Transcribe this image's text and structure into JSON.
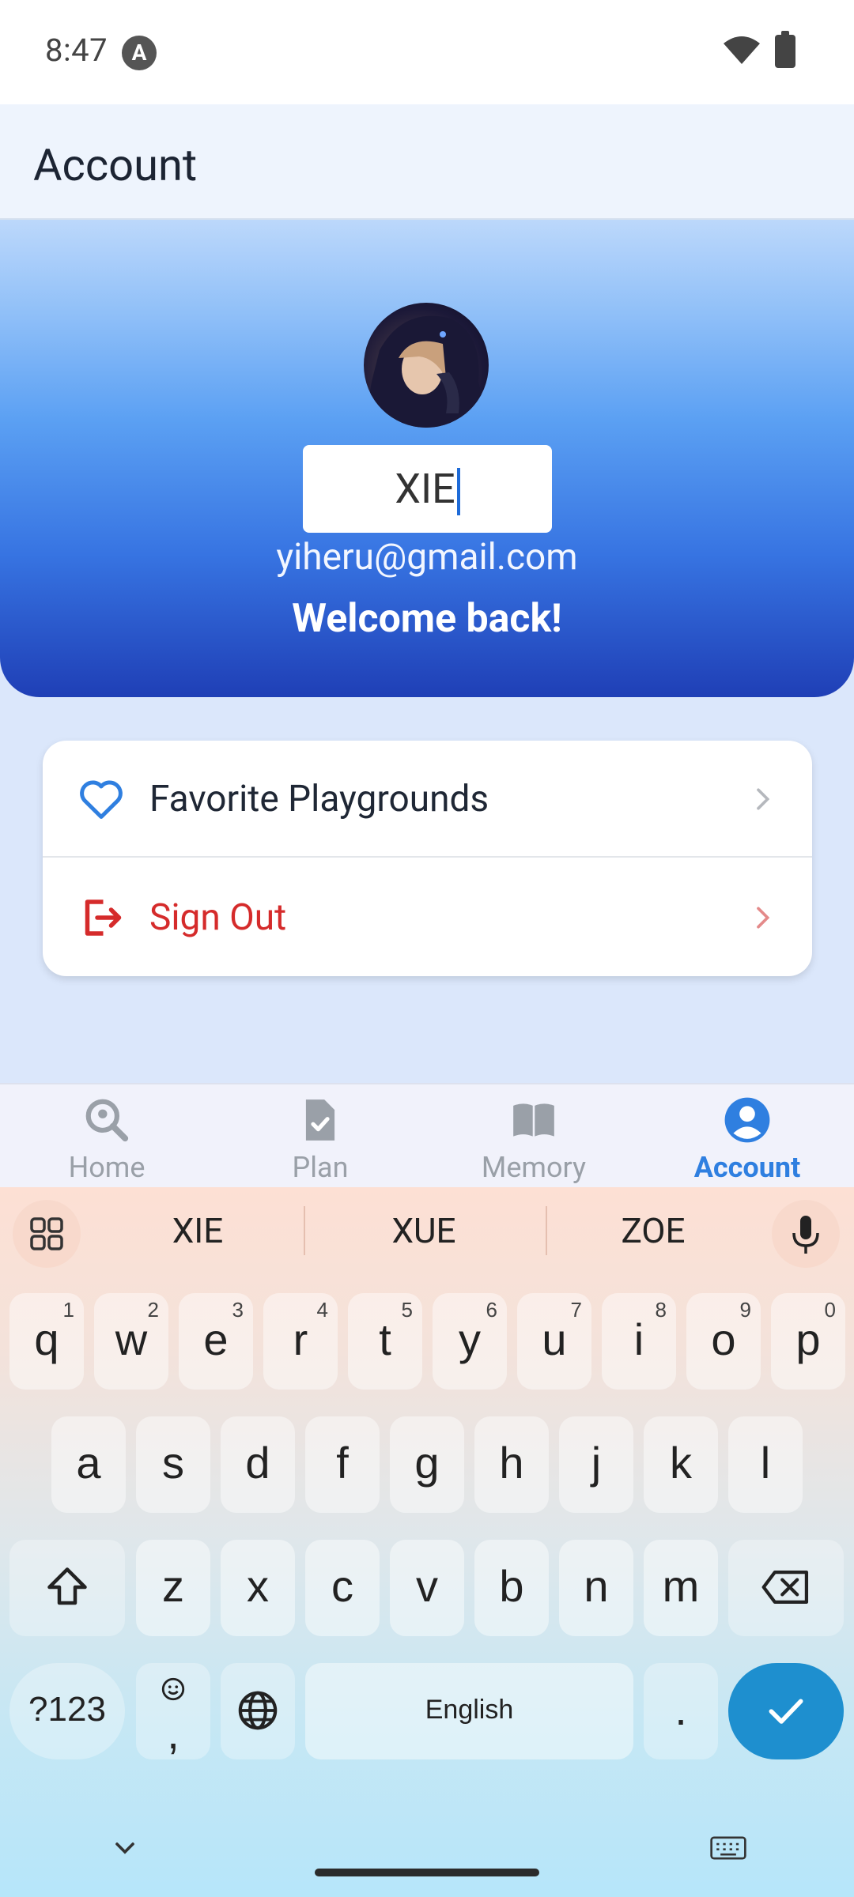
{
  "status_bar": {
    "time": "8:47",
    "notification_icon": "A"
  },
  "header": {
    "title": "Account"
  },
  "profile": {
    "name_value": "XIE",
    "email": "yiheru@gmail.com",
    "greeting": "Welcome back!"
  },
  "menu": {
    "favorites_label": "Favorite Playgrounds",
    "signout_label": "Sign Out"
  },
  "nav": {
    "items": [
      {
        "label": "Home",
        "icon": "search-location-icon"
      },
      {
        "label": "Plan",
        "icon": "file-check-icon"
      },
      {
        "label": "Memory",
        "icon": "book-icon"
      },
      {
        "label": "Account",
        "icon": "account-circle-icon",
        "active": true
      }
    ]
  },
  "keyboard": {
    "suggestions": [
      "XIE",
      "XUE",
      "ZOE"
    ],
    "row1": [
      {
        "k": "q",
        "n": "1"
      },
      {
        "k": "w",
        "n": "2"
      },
      {
        "k": "e",
        "n": "3"
      },
      {
        "k": "r",
        "n": "4"
      },
      {
        "k": "t",
        "n": "5"
      },
      {
        "k": "y",
        "n": "6"
      },
      {
        "k": "u",
        "n": "7"
      },
      {
        "k": "i",
        "n": "8"
      },
      {
        "k": "o",
        "n": "9"
      },
      {
        "k": "p",
        "n": "0"
      }
    ],
    "row2": [
      "a",
      "s",
      "d",
      "f",
      "g",
      "h",
      "j",
      "k",
      "l"
    ],
    "row3": [
      "z",
      "x",
      "c",
      "v",
      "b",
      "n",
      "m"
    ],
    "symbols_label": "?123",
    "emoji_comma": ",",
    "space_label": "English",
    "period_label": "."
  },
  "colors": {
    "accent": "#2f7fe0",
    "danger": "#d52b2b",
    "enter_key": "#1e8fcf"
  }
}
